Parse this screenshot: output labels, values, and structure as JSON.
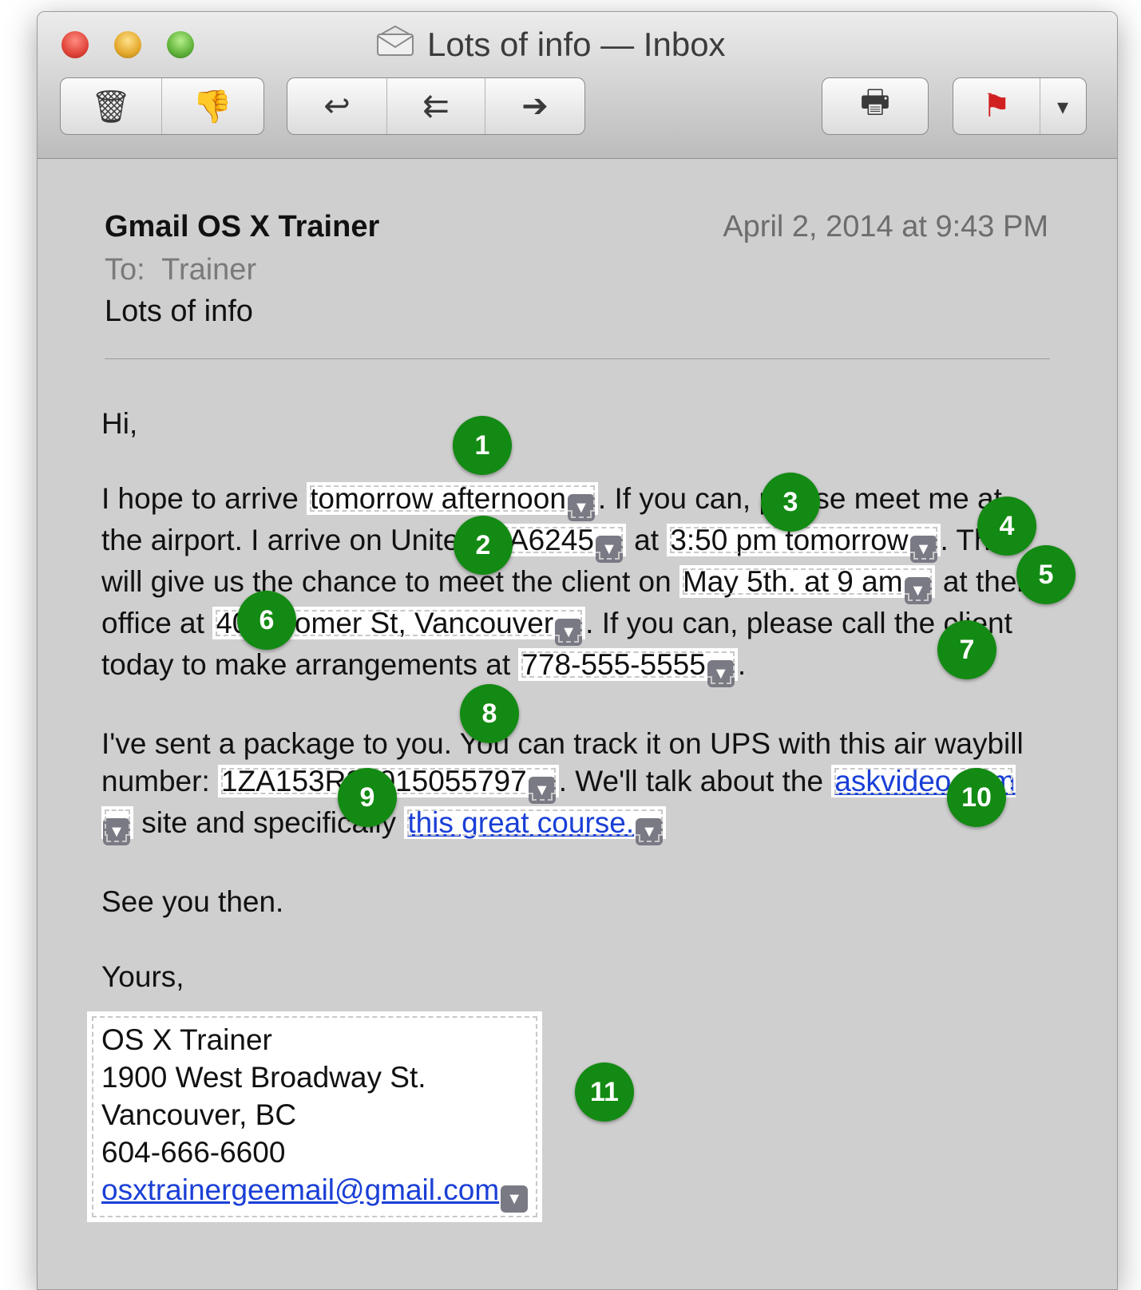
{
  "window": {
    "title": "Lots of info — Inbox"
  },
  "toolbar": {
    "delete_icon": "🗑",
    "junk_icon": "👎",
    "reply_icon": "↩",
    "reply_all_icon": "⇇",
    "forward_icon": "➔",
    "print_icon": "🖶",
    "flag_icon": "⚑",
    "flag_dropdown_icon": "▾"
  },
  "message": {
    "from": "Gmail OS X Trainer",
    "date": "April 2, 2014 at 9:43 PM",
    "to_label": "To:",
    "to_value": "Trainer",
    "subject": "Lots of info",
    "greeting": "Hi,",
    "p1": {
      "t1": "I hope to arrive ",
      "d1": "tomorrow afternoon",
      "t2": ". If you can, please meet me at the airport. I arrive on United ",
      "d2": "UA6245",
      "t3": " at ",
      "d3": "3:50 pm tomorrow",
      "t4": ". This will give us the chance to meet the client on ",
      "d4": "May 5th. at 9 am",
      "t5": " at their office at ",
      "d5": "400 Homer St, Vancouver",
      "t6": ". If you can, please call the client today to make arrangements at ",
      "d6": "778-555-5555",
      "t7": "."
    },
    "p2": {
      "t1": "I've sent a package to you. You can track it on UPS with this air waybill number: ",
      "d1": "1ZA153R92015055797",
      "t2": ". We'll talk about the ",
      "link1": "askvideo.com",
      "t3": " site and specifically ",
      "link2": "this great course.",
      "t4": ""
    },
    "closing1": "See you then.",
    "closing2": "Yours,",
    "signature": {
      "name": "OS X Trainer",
      "address": "1900 West Broadway St.",
      "city": "Vancouver, BC",
      "phone": "604-666-6600",
      "email": "osxtrainergeemail@gmail.com"
    },
    "dropdown_glyph": "▼"
  },
  "badges": [
    "1",
    "2",
    "3",
    "4",
    "5",
    "6",
    "7",
    "8",
    "9",
    "10",
    "11"
  ],
  "colors": {
    "badge": "#138a13",
    "link": "#1a3fd6",
    "window_bg": "#cfcfcf"
  }
}
